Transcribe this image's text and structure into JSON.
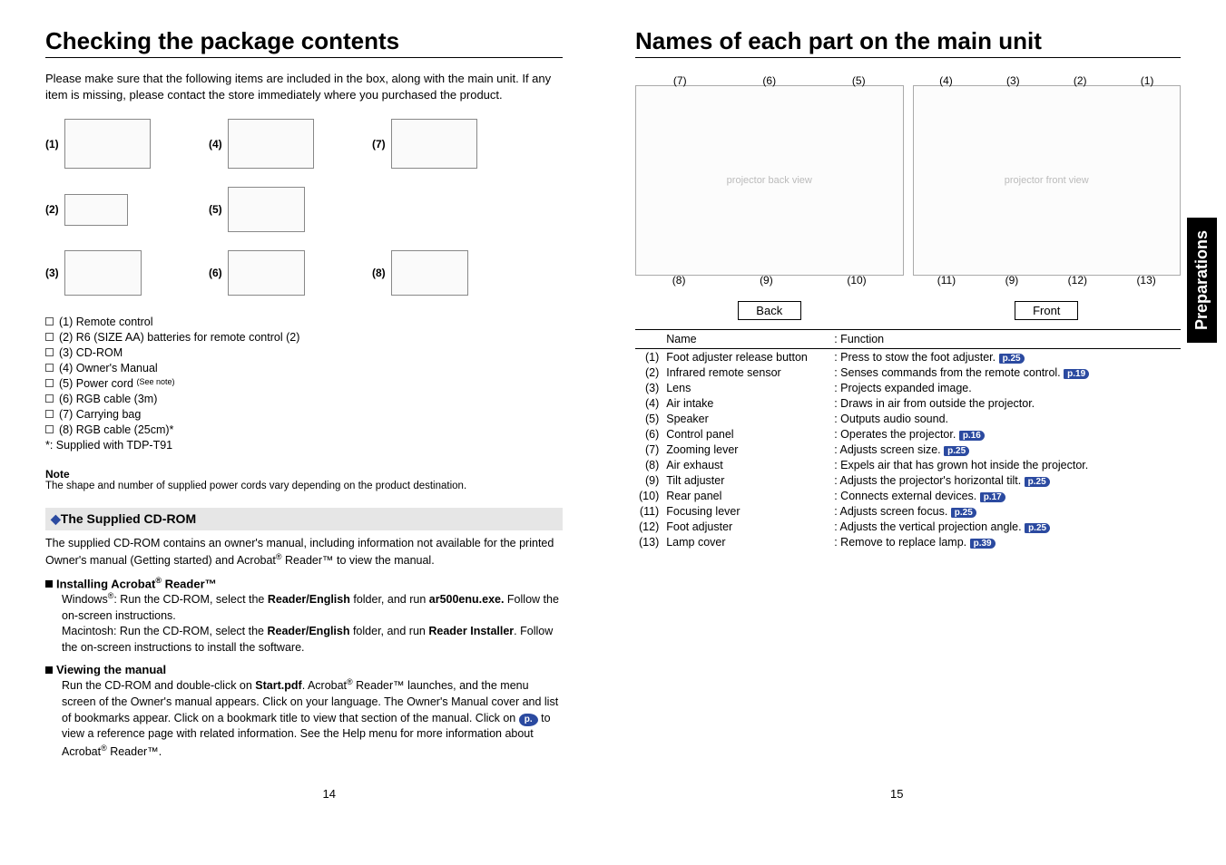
{
  "left": {
    "title": "Checking the package contents",
    "intro": "Please make sure that the following items are included in the box, along with the main unit. If any item is missing, please contact the store immediately where you purchased the product.",
    "gridLabels": {
      "i1": "(1)",
      "i2": "(2)",
      "i3": "(3)",
      "i4": "(4)",
      "i5": "(5)",
      "i6": "(6)",
      "i7": "(7)",
      "i8": "(8)"
    },
    "checklist": [
      "(1)  Remote control",
      "(2)  R6 (SIZE AA) batteries for remote control (2)",
      "(3)  CD-ROM",
      "(4)  Owner's Manual"
    ],
    "checklist5_pre": "(5)  Power cord ",
    "checklist5_note": "(See note)",
    "checklist_rest": [
      "(6)  RGB cable (3m)",
      "(7)  Carrying bag",
      "(8)  RGB cable (25cm)*"
    ],
    "supplied_note": "*: Supplied with TDP-T91",
    "note_head": "Note",
    "note_body": "The shape and number of supplied power cords vary depending on the product destination.",
    "cd_head": "The Supplied CD-ROM",
    "cd_body_1": "The supplied CD-ROM contains an owner's manual, including information not available for the printed Owner's manual (Getting started) and Acrobat",
    "cd_body_2": " Reader™ to view the manual.",
    "install_head": "Installing Acrobat",
    "install_head2": " Reader™",
    "install_win_1": "Windows",
    "install_win_2": ": Run the CD-ROM, select the ",
    "install_win_bold1": "Reader/English",
    "install_win_3": " folder, and run ",
    "install_win_bold2": "ar500enu.exe.",
    "install_win_4": " Follow the on-screen instructions.",
    "install_mac_1": "Macintosh: Run the CD-ROM, select the ",
    "install_mac_bold1": "Reader/English",
    "install_mac_2": " folder, and run ",
    "install_mac_bold2": "Reader Installer",
    "install_mac_3": ". Follow the on-screen instructions to install the software.",
    "view_head": "Viewing the manual",
    "view_1": "Run the CD-ROM and double-click on ",
    "view_bold1": "Start.pdf",
    "view_2": ". Acrobat",
    "view_3": " Reader™ launches, and the menu screen of the Owner's manual appears. Click on your language. The Owner's Manual cover and list of bookmarks appear. Click on a bookmark title to view that section of the manual. Click on ",
    "view_pref": "p.  ",
    "view_4": " to view a reference page with related information. See the Help menu for more information about Acrobat",
    "view_5": " Reader™.",
    "page_no": "14"
  },
  "right": {
    "title": "Names of each part on the main unit",
    "tab_label": "Preparations",
    "back_callouts_top": [
      "(7)",
      "(6)",
      "(5)"
    ],
    "back_callouts_bottom": [
      "(8)",
      "(9)",
      "(10)"
    ],
    "front_callouts_top": [
      "(4)",
      "(3)",
      "(2)",
      "(1)"
    ],
    "front_callouts_bottom": [
      "(11)",
      "(9)",
      "(12)",
      "(13)"
    ],
    "label_back": "Back",
    "label_front": "Front",
    "th_name": "Name",
    "th_func": ": Function",
    "rows": [
      {
        "idx": "(1)",
        "name": "Foot adjuster release button",
        "fn": ": Press to stow the foot adjuster. ",
        "ref": "p.25"
      },
      {
        "idx": "(2)",
        "name": "Infrared remote sensor",
        "fn": ": Senses commands from the remote control. ",
        "ref": "p.19"
      },
      {
        "idx": "(3)",
        "name": "Lens",
        "fn": ": Projects expanded image.",
        "ref": ""
      },
      {
        "idx": "(4)",
        "name": "Air intake",
        "fn": ": Draws in air from outside the projector.",
        "ref": ""
      },
      {
        "idx": "(5)",
        "name": "Speaker",
        "fn": ": Outputs audio sound.",
        "ref": ""
      },
      {
        "idx": "(6)",
        "name": "Control panel",
        "fn": ": Operates the projector. ",
        "ref": "p.16"
      },
      {
        "idx": "(7)",
        "name": "Zooming lever",
        "fn": ": Adjusts screen size. ",
        "ref": "p.25"
      },
      {
        "idx": "(8)",
        "name": "Air exhaust",
        "fn": ": Expels air that has grown hot inside the projector.",
        "ref": ""
      },
      {
        "idx": "(9)",
        "name": "Tilt adjuster",
        "fn": ": Adjusts the projector's horizontal tilt. ",
        "ref": "p.25"
      },
      {
        "idx": "(10)",
        "name": "Rear panel",
        "fn": ": Connects external devices. ",
        "ref": "p.17"
      },
      {
        "idx": "(11)",
        "name": "Focusing lever",
        "fn": ": Adjusts screen focus. ",
        "ref": "p.25"
      },
      {
        "idx": "(12)",
        "name": "Foot adjuster",
        "fn": ": Adjusts the vertical projection angle. ",
        "ref": "p.25"
      },
      {
        "idx": "(13)",
        "name": "Lamp cover",
        "fn": ": Remove to replace lamp. ",
        "ref": "p.39"
      }
    ],
    "page_no": "15"
  }
}
